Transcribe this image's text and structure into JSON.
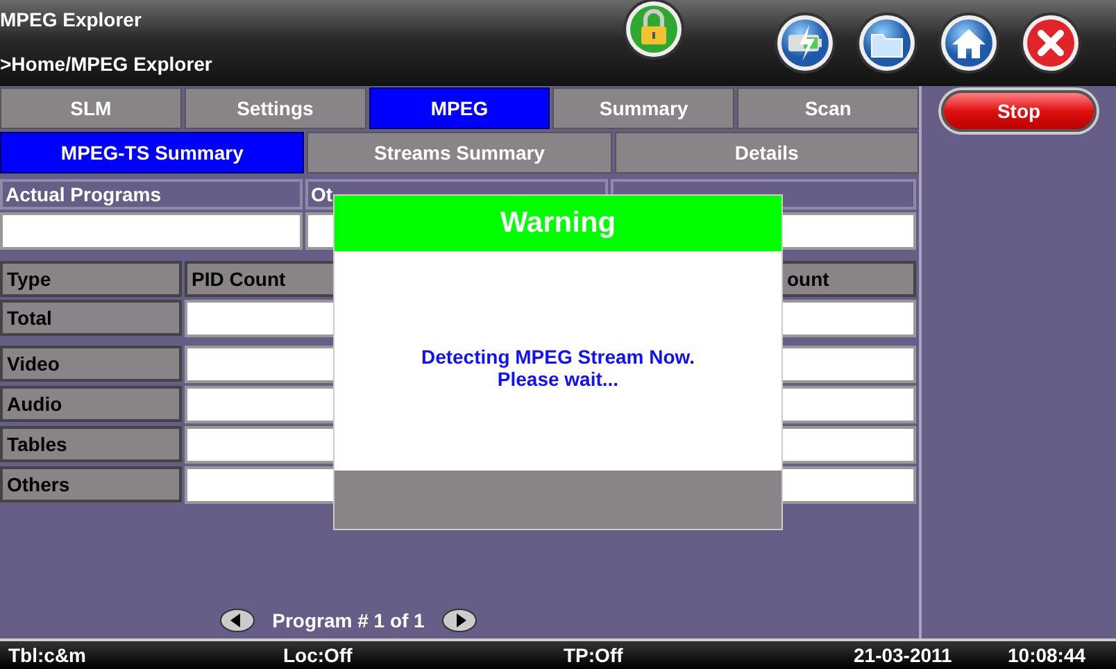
{
  "header": {
    "title": "MPEG Explorer",
    "breadcrumb": ">Home/MPEG Explorer"
  },
  "tabs": [
    {
      "label": "SLM",
      "selected": false
    },
    {
      "label": "Settings",
      "selected": false
    },
    {
      "label": "MPEG",
      "selected": true
    },
    {
      "label": "Summary",
      "selected": false
    },
    {
      "label": "Scan",
      "selected": false
    }
  ],
  "subtabs": [
    {
      "label": "MPEG-TS Summary",
      "selected": true
    },
    {
      "label": "Streams Summary",
      "selected": false
    },
    {
      "label": "Details",
      "selected": false
    }
  ],
  "programs_table": {
    "columns": [
      "Actual Programs",
      "Ot"
    ]
  },
  "pid_table": {
    "columns": [
      "Type",
      "PID Count",
      "ount"
    ],
    "rows": [
      "Total",
      "Video",
      "Audio",
      "Tables",
      "Others"
    ]
  },
  "pager": {
    "label": "Program # 1 of 1"
  },
  "stop_button": "Stop",
  "dialog": {
    "title": "Warning",
    "message": "Detecting MPEG Stream Now.\nPlease wait..."
  },
  "status_bar": [
    "Tbl:c&m",
    "Loc:Off",
    "TP:Off",
    "21-03-2011",
    "10:08:44"
  ]
}
